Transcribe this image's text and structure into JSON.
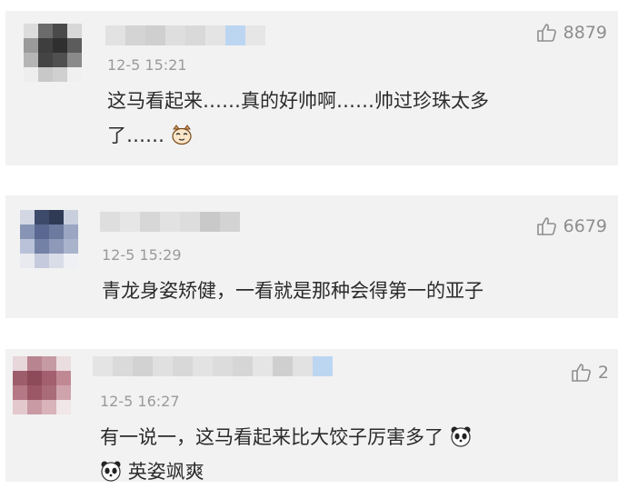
{
  "comments": [
    {
      "time": "12-5 15:21",
      "likes": "8879",
      "text_line1": "这马看起来……真的好帅啊……帅过珍珠太多",
      "text_line2": "了……",
      "emoji": "cat-face-icon"
    },
    {
      "time": "12-5 15:29",
      "likes": "6679",
      "text_line1": "青龙身姿矫健，一看就是那种会得第一的亚子"
    },
    {
      "time": "12-5 16:27",
      "likes": "2",
      "text_line1": "有一说一，这马看起来比大饺子厉害多了",
      "text_line2": "英姿飒爽",
      "emoji": "panda-face-icon"
    }
  ],
  "colors": {
    "card_bg": "#f2f2f2",
    "text": "#2b2b2b",
    "meta": "#9a9a9a",
    "mosaic_accent": "#bcd6f2"
  }
}
